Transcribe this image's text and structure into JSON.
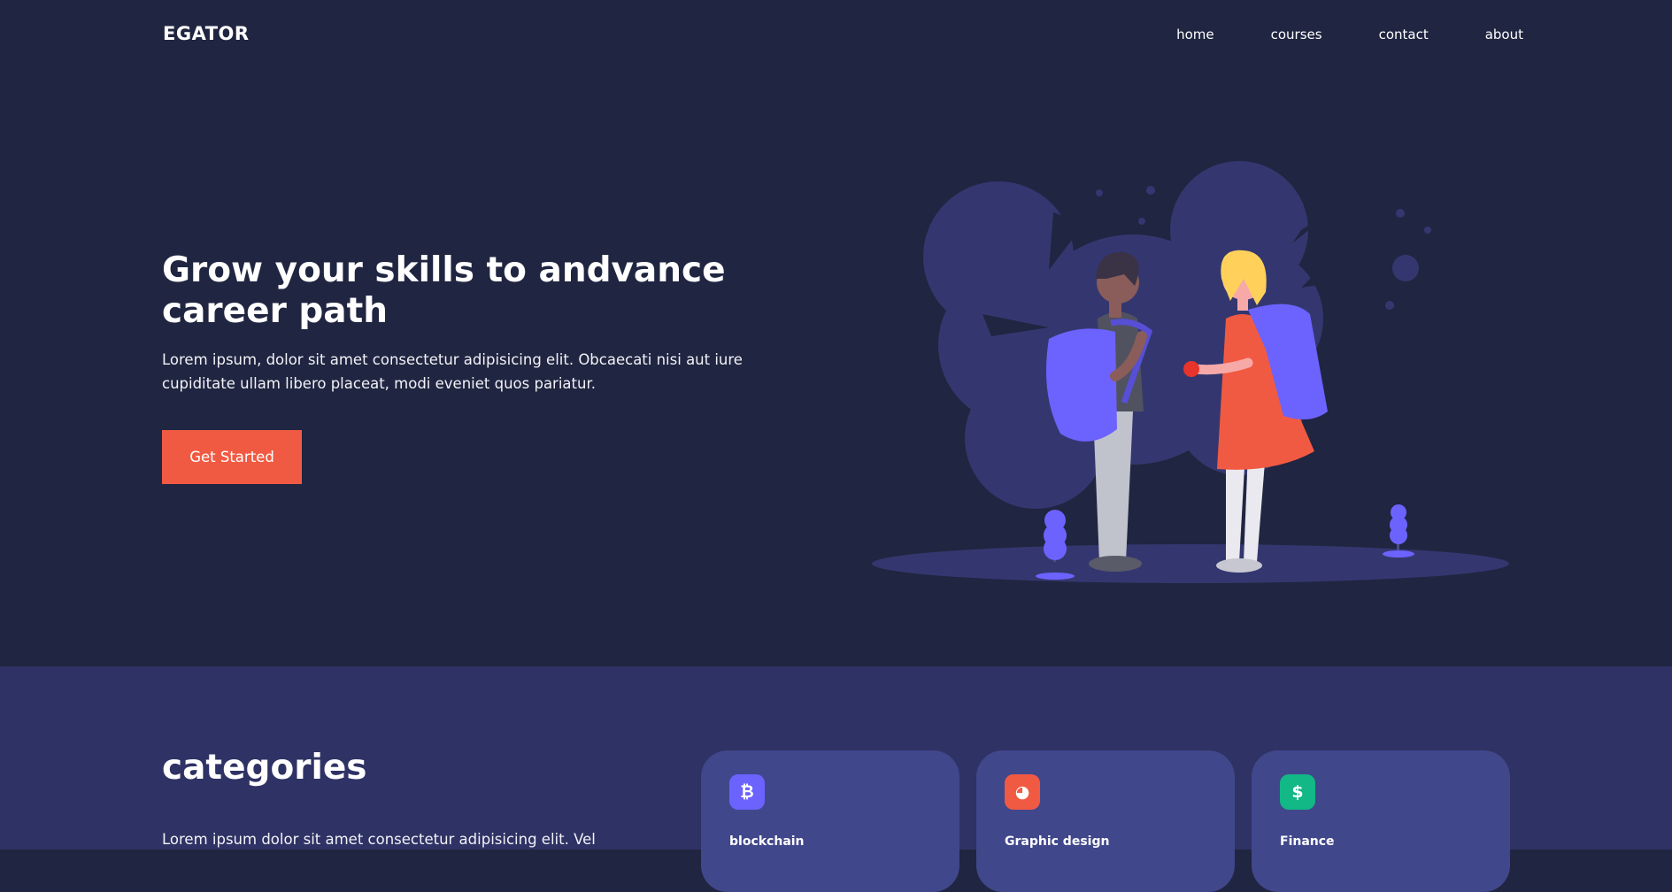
{
  "header": {
    "logo": "EGATOR",
    "nav": [
      "home",
      "courses",
      "contact",
      "about"
    ]
  },
  "hero": {
    "title": "Grow your skills to andvance career path",
    "text": "Lorem ipsum, dolor sit amet consectetur adipisicing elit. Obcaecati nisi aut iure cupiditate ullam libero placeat, modi eveniet quos pariatur.",
    "cta_label": "Get Started"
  },
  "categories": {
    "title": "categories",
    "text": "Lorem ipsum dolor sit amet consectetur adipisicing elit. Vel",
    "cards": [
      {
        "label": "blockchain",
        "icon": "bitcoin-icon",
        "icon_glyph": "₿",
        "color": "#6c63ff"
      },
      {
        "label": "Graphic design",
        "icon": "palette-icon",
        "icon_glyph": "◕",
        "color": "#f15a42"
      },
      {
        "label": "Finance",
        "icon": "dollar-icon",
        "icon_glyph": "$",
        "color": "#12b886"
      }
    ]
  },
  "colors": {
    "background": "#202541",
    "section_bg": "#2f3264",
    "card_bg": "#41478b",
    "accent": "#f15a42",
    "illustration_purple": "#6c63ff"
  }
}
